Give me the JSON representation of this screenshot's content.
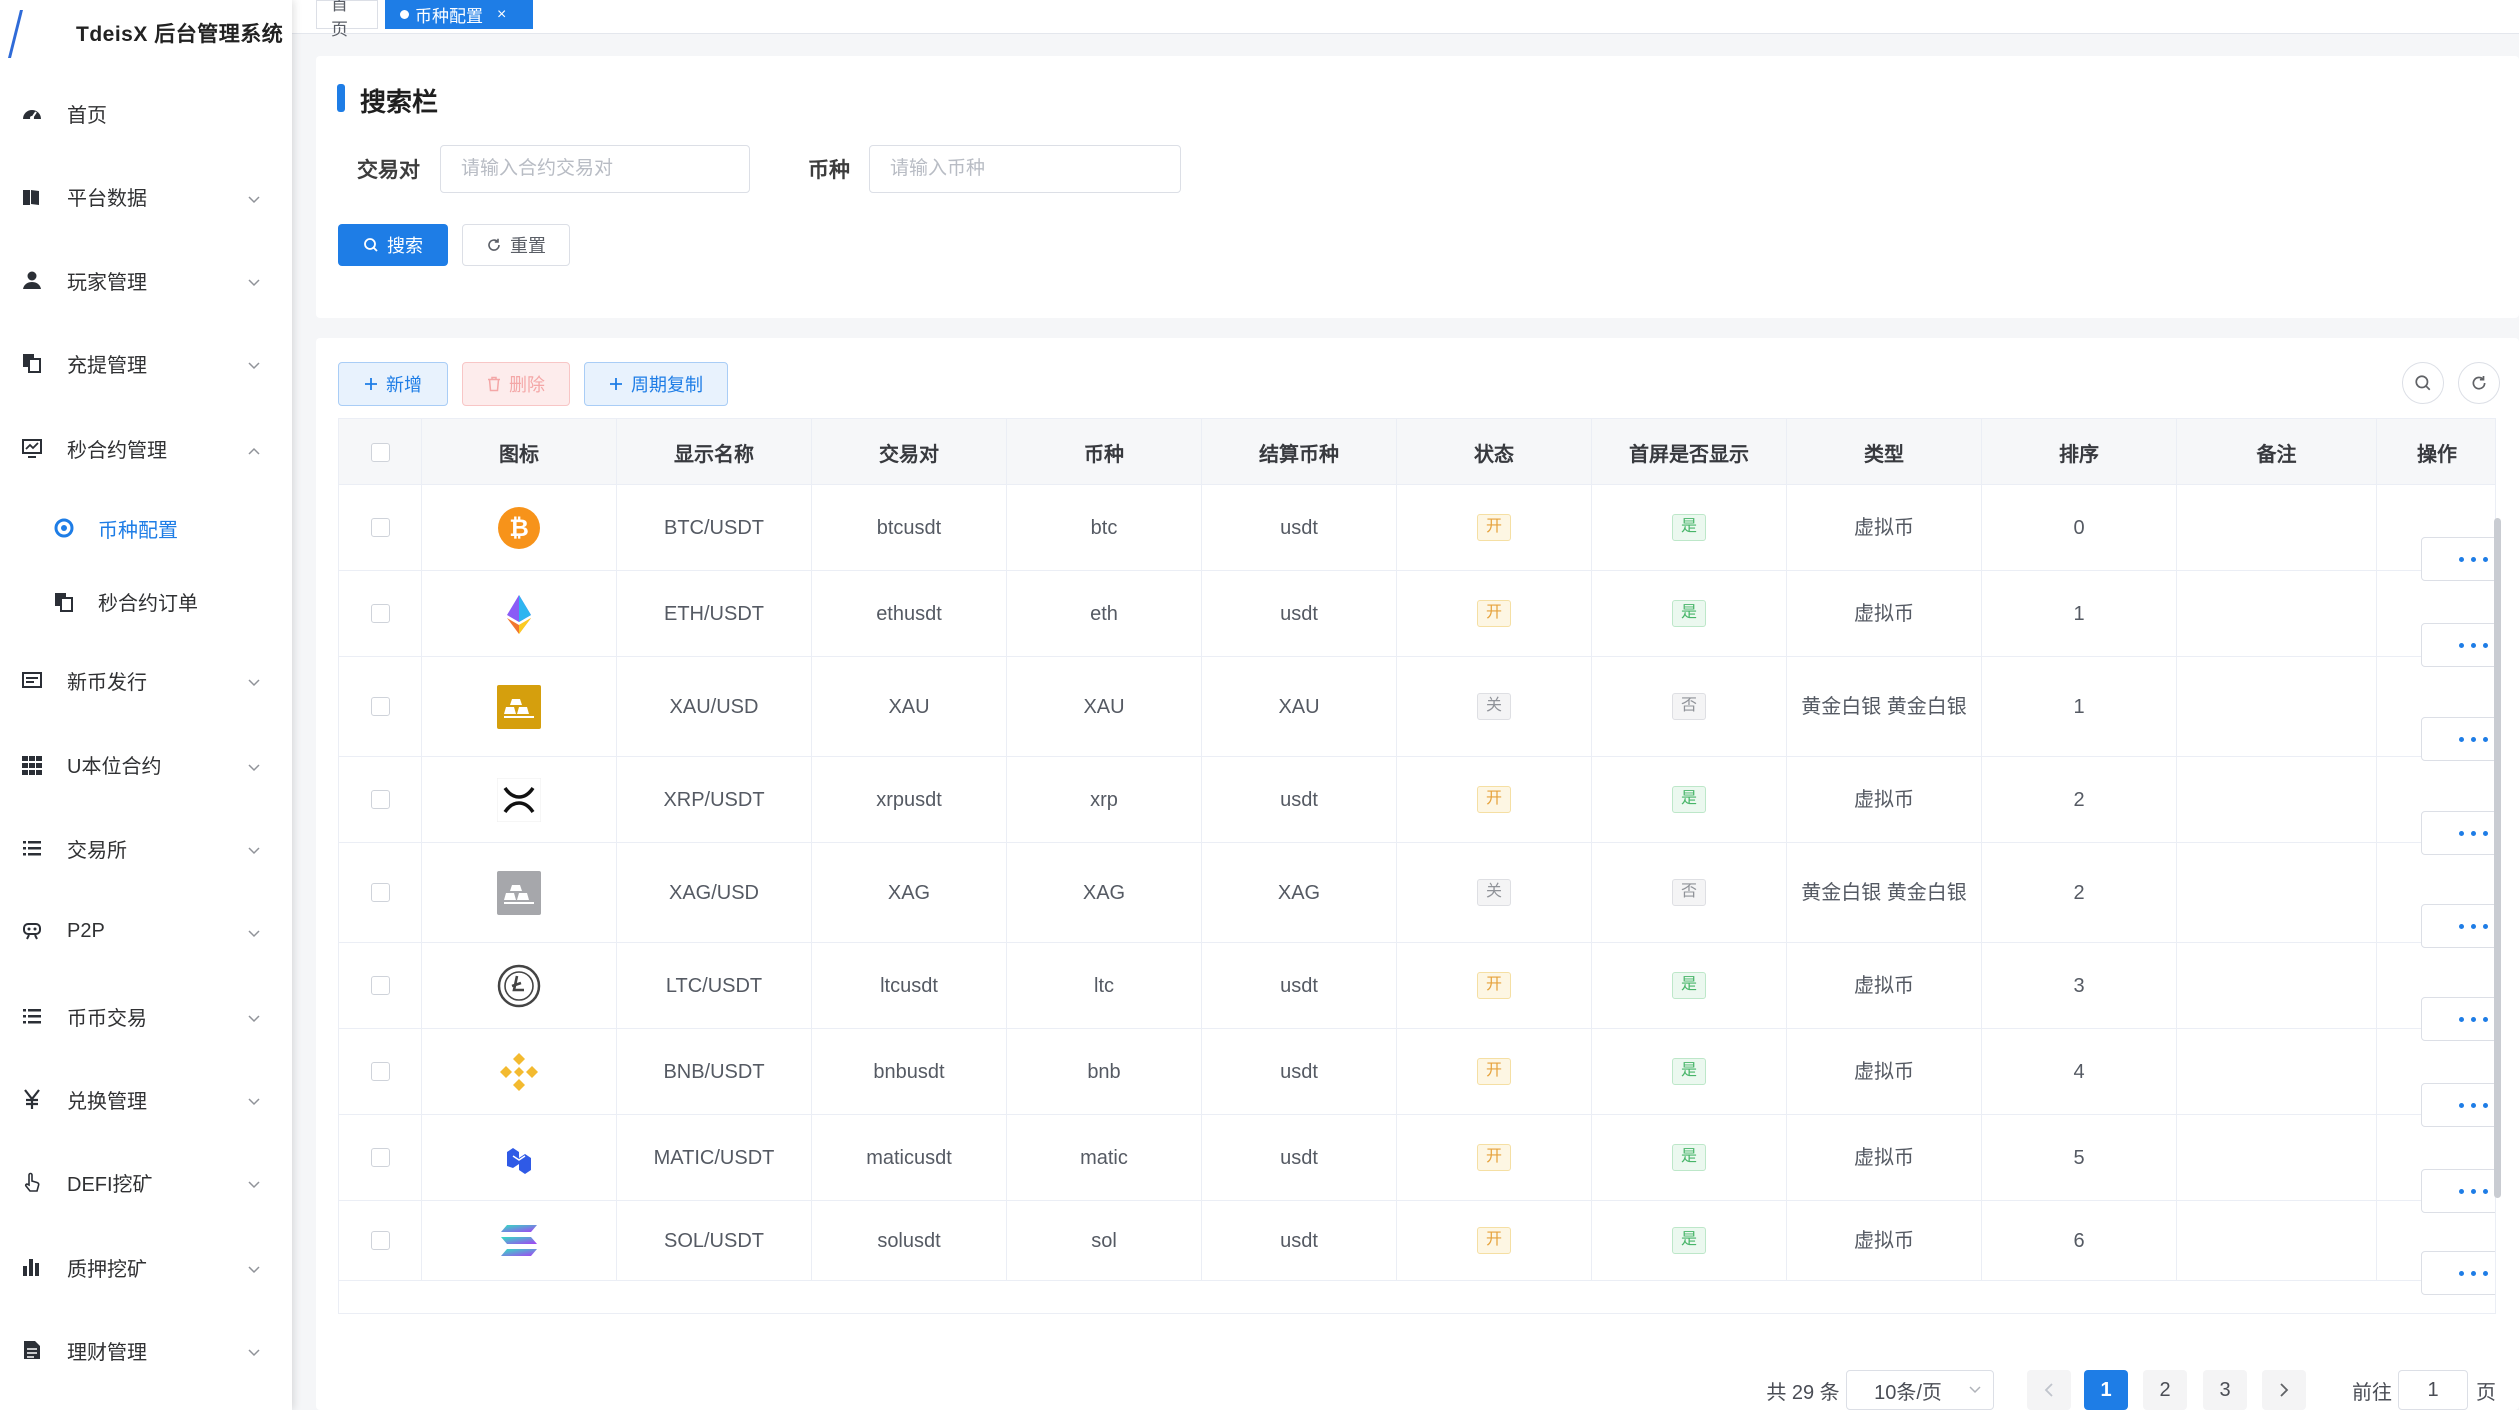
{
  "app": {
    "title": "TdeisX 后台管理系统"
  },
  "tabs": {
    "home": "首页",
    "current": "币种配置",
    "close": "×"
  },
  "sidebar": {
    "items": [
      {
        "label": "首页",
        "icon": "dashboard-icon"
      },
      {
        "label": "平台数据",
        "icon": "book-icon"
      },
      {
        "label": "玩家管理",
        "icon": "user-icon"
      },
      {
        "label": "充提管理",
        "icon": "copy-icon"
      },
      {
        "label": "秒合约管理",
        "icon": "chart-icon"
      },
      {
        "label": "币种配置",
        "icon": "coin-icon"
      },
      {
        "label": "秒合约订单",
        "icon": "copy-icon"
      },
      {
        "label": "新币发行",
        "icon": "card-icon"
      },
      {
        "label": "U本位合约",
        "icon": "grid-icon"
      },
      {
        "label": "交易所",
        "icon": "list-icon"
      },
      {
        "label": "P2P",
        "icon": "peer-icon"
      },
      {
        "label": "币币交易",
        "icon": "list-icon"
      },
      {
        "label": "兑换管理",
        "icon": "yen-icon"
      },
      {
        "label": "DEFI挖矿",
        "icon": "hand-icon"
      },
      {
        "label": "质押挖矿",
        "icon": "bar-chart-icon"
      },
      {
        "label": "理财管理",
        "icon": "document-icon"
      }
    ]
  },
  "search": {
    "title": "搜索栏",
    "pair_label": "交易对",
    "pair_placeholder": "请输入合约交易对",
    "coin_label": "币种",
    "coin_placeholder": "请输入币种",
    "search_btn": "搜索",
    "reset_btn": "重置"
  },
  "toolbar": {
    "add": "新增",
    "delete": "删除",
    "copy": "周期复制"
  },
  "table": {
    "headers": [
      "图标",
      "显示名称",
      "交易对",
      "币种",
      "结算币种",
      "状态",
      "首屏是否显示",
      "类型",
      "排序",
      "备注",
      "操作"
    ],
    "rows": [
      {
        "icon": "btc-icon",
        "name": "BTC/USDT",
        "pair": "btcusdt",
        "coin": "btc",
        "settle": "usdt",
        "status": "开",
        "home": "是",
        "type": "虚拟币",
        "sort": "0",
        "note": ""
      },
      {
        "icon": "eth-icon",
        "name": "ETH/USDT",
        "pair": "ethusdt",
        "coin": "eth",
        "settle": "usdt",
        "status": "开",
        "home": "是",
        "type": "虚拟币",
        "sort": "1",
        "note": ""
      },
      {
        "icon": "gold-icon",
        "name": "XAU/USD",
        "pair": "XAU",
        "coin": "XAU",
        "settle": "XAU",
        "status": "关",
        "home": "否",
        "type": "黄金白银 黄金白银",
        "sort": "1",
        "note": ""
      },
      {
        "icon": "xrp-icon",
        "name": "XRP/USDT",
        "pair": "xrpusdt",
        "coin": "xrp",
        "settle": "usdt",
        "status": "开",
        "home": "是",
        "type": "虚拟币",
        "sort": "2",
        "note": ""
      },
      {
        "icon": "silver-icon",
        "name": "XAG/USD",
        "pair": "XAG",
        "coin": "XAG",
        "settle": "XAG",
        "status": "关",
        "home": "否",
        "type": "黄金白银 黄金白银",
        "sort": "2",
        "note": ""
      },
      {
        "icon": "ltc-icon",
        "name": "LTC/USDT",
        "pair": "ltcusdt",
        "coin": "ltc",
        "settle": "usdt",
        "status": "开",
        "home": "是",
        "type": "虚拟币",
        "sort": "3",
        "note": ""
      },
      {
        "icon": "bnb-icon",
        "name": "BNB/USDT",
        "pair": "bnbusdt",
        "coin": "bnb",
        "settle": "usdt",
        "status": "开",
        "home": "是",
        "type": "虚拟币",
        "sort": "4",
        "note": ""
      },
      {
        "icon": "matic-icon",
        "name": "MATIC/USDT",
        "pair": "maticusdt",
        "coin": "matic",
        "settle": "usdt",
        "status": "开",
        "home": "是",
        "type": "虚拟币",
        "sort": "5",
        "note": ""
      },
      {
        "icon": "sol-icon",
        "name": "SOL/USDT",
        "pair": "solusdt",
        "coin": "sol",
        "settle": "usdt",
        "status": "开",
        "home": "是",
        "type": "虚拟币",
        "sort": "6",
        "note": ""
      }
    ]
  },
  "pagination": {
    "total": "共 29 条",
    "page_size": "10条/页",
    "pages": [
      "1",
      "2",
      "3"
    ],
    "current": "1",
    "goto_label": "前往",
    "goto_value": "1",
    "page_unit": "页"
  },
  "colors": {
    "primary": "#1e7de6",
    "warning": "#e6a23c",
    "success": "#47b568",
    "danger": "#f4a7a7"
  }
}
